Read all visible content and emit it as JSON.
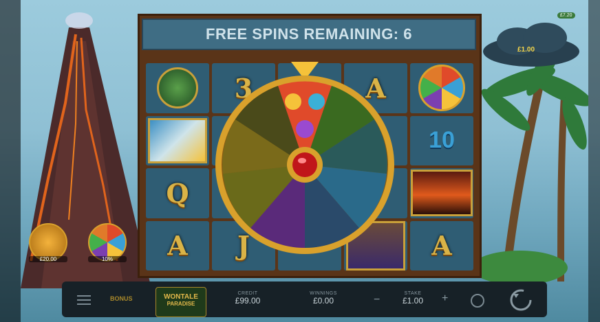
{
  "banner": {
    "text": "FREE SPINS REMAINING: 6"
  },
  "reels": [
    [
      "turtle",
      "3",
      "wheel-top",
      "A",
      "wheel"
    ],
    [
      "wave",
      "",
      "",
      "",
      "10"
    ],
    [
      "Q",
      "",
      "",
      "",
      "volcano"
    ],
    [
      "A",
      "J",
      "",
      "woman",
      "A"
    ]
  ],
  "left_features": [
    {
      "value": "£20.00",
      "icon": "volcano-coin-icon"
    },
    {
      "value": "10%",
      "icon": "wheel-coin-icon"
    }
  ],
  "cloud": {
    "value": "£1.00",
    "badge": "£7.20"
  },
  "bottom_bar": {
    "bonus_label": "BONUS",
    "logo_line1": "WONTALE",
    "logo_line2": "PARADISE",
    "credit_label": "CREDIT",
    "credit_value": "£99.00",
    "winnings_label": "WINNINGS",
    "winnings_value": "£0.00",
    "minus": "−",
    "stake_label": "STAKE",
    "stake_value": "£1.00",
    "plus": "+"
  },
  "colors": {
    "frame": "#5a3418",
    "wheel_rim": "#d9a12c",
    "banner_bg": "#3f6d84"
  }
}
